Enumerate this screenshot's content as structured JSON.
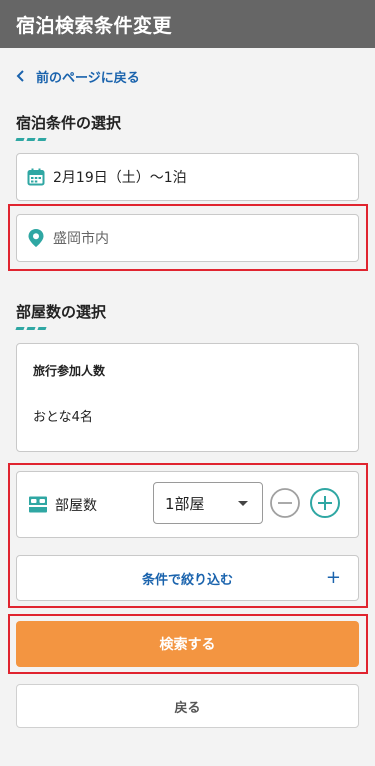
{
  "header": {
    "title": "宿泊検索条件変更"
  },
  "nav": {
    "back_link": "前のページに戻る"
  },
  "stay_section": {
    "title": "宿泊条件の選択",
    "date_value": "2月19日（土）～1泊",
    "destination_value": "盛岡市内"
  },
  "room_section": {
    "title": "部屋数の選択",
    "guests_label": "旅行参加人数",
    "guests_value": "おとな4名",
    "rooms_label": "部屋数",
    "rooms_selected": "1部屋"
  },
  "filter": {
    "label": "条件で絞り込む",
    "plus": "+"
  },
  "actions": {
    "search_label": "検索する",
    "back_label": "戻る"
  },
  "colors": {
    "header_bg": "#666666",
    "link": "#1a63ad",
    "accent_teal": "#2fa7a3",
    "search_button": "#f39541",
    "highlight_frame": "#e0242f"
  },
  "icons": [
    "chevron-left-icon",
    "calendar-icon",
    "map-pin-icon",
    "bed-icon",
    "minus-circle-icon",
    "plus-circle-icon"
  ]
}
